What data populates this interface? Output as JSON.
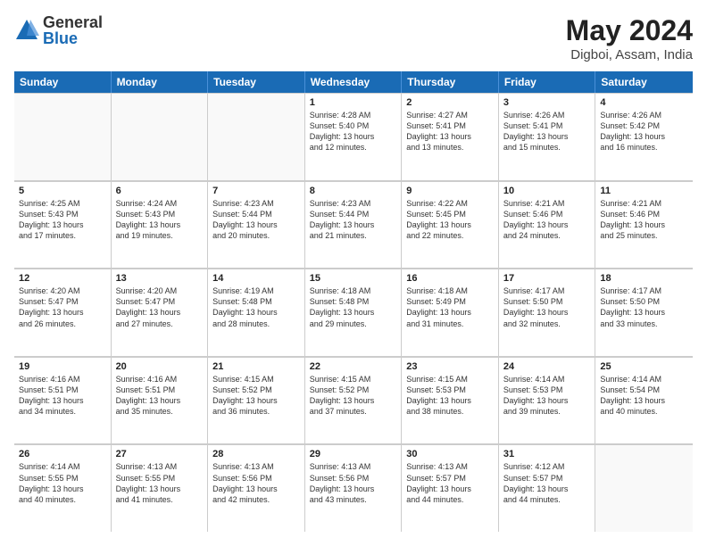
{
  "logo": {
    "general": "General",
    "blue": "Blue"
  },
  "title": "May 2024",
  "subtitle": "Digboi, Assam, India",
  "header_days": [
    "Sunday",
    "Monday",
    "Tuesday",
    "Wednesday",
    "Thursday",
    "Friday",
    "Saturday"
  ],
  "weeks": [
    [
      {
        "day": "",
        "text": ""
      },
      {
        "day": "",
        "text": ""
      },
      {
        "day": "",
        "text": ""
      },
      {
        "day": "1",
        "text": "Sunrise: 4:28 AM\nSunset: 5:40 PM\nDaylight: 13 hours\nand 12 minutes."
      },
      {
        "day": "2",
        "text": "Sunrise: 4:27 AM\nSunset: 5:41 PM\nDaylight: 13 hours\nand 13 minutes."
      },
      {
        "day": "3",
        "text": "Sunrise: 4:26 AM\nSunset: 5:41 PM\nDaylight: 13 hours\nand 15 minutes."
      },
      {
        "day": "4",
        "text": "Sunrise: 4:26 AM\nSunset: 5:42 PM\nDaylight: 13 hours\nand 16 minutes."
      }
    ],
    [
      {
        "day": "5",
        "text": "Sunrise: 4:25 AM\nSunset: 5:43 PM\nDaylight: 13 hours\nand 17 minutes."
      },
      {
        "day": "6",
        "text": "Sunrise: 4:24 AM\nSunset: 5:43 PM\nDaylight: 13 hours\nand 19 minutes."
      },
      {
        "day": "7",
        "text": "Sunrise: 4:23 AM\nSunset: 5:44 PM\nDaylight: 13 hours\nand 20 minutes."
      },
      {
        "day": "8",
        "text": "Sunrise: 4:23 AM\nSunset: 5:44 PM\nDaylight: 13 hours\nand 21 minutes."
      },
      {
        "day": "9",
        "text": "Sunrise: 4:22 AM\nSunset: 5:45 PM\nDaylight: 13 hours\nand 22 minutes."
      },
      {
        "day": "10",
        "text": "Sunrise: 4:21 AM\nSunset: 5:46 PM\nDaylight: 13 hours\nand 24 minutes."
      },
      {
        "day": "11",
        "text": "Sunrise: 4:21 AM\nSunset: 5:46 PM\nDaylight: 13 hours\nand 25 minutes."
      }
    ],
    [
      {
        "day": "12",
        "text": "Sunrise: 4:20 AM\nSunset: 5:47 PM\nDaylight: 13 hours\nand 26 minutes."
      },
      {
        "day": "13",
        "text": "Sunrise: 4:20 AM\nSunset: 5:47 PM\nDaylight: 13 hours\nand 27 minutes."
      },
      {
        "day": "14",
        "text": "Sunrise: 4:19 AM\nSunset: 5:48 PM\nDaylight: 13 hours\nand 28 minutes."
      },
      {
        "day": "15",
        "text": "Sunrise: 4:18 AM\nSunset: 5:48 PM\nDaylight: 13 hours\nand 29 minutes."
      },
      {
        "day": "16",
        "text": "Sunrise: 4:18 AM\nSunset: 5:49 PM\nDaylight: 13 hours\nand 31 minutes."
      },
      {
        "day": "17",
        "text": "Sunrise: 4:17 AM\nSunset: 5:50 PM\nDaylight: 13 hours\nand 32 minutes."
      },
      {
        "day": "18",
        "text": "Sunrise: 4:17 AM\nSunset: 5:50 PM\nDaylight: 13 hours\nand 33 minutes."
      }
    ],
    [
      {
        "day": "19",
        "text": "Sunrise: 4:16 AM\nSunset: 5:51 PM\nDaylight: 13 hours\nand 34 minutes."
      },
      {
        "day": "20",
        "text": "Sunrise: 4:16 AM\nSunset: 5:51 PM\nDaylight: 13 hours\nand 35 minutes."
      },
      {
        "day": "21",
        "text": "Sunrise: 4:15 AM\nSunset: 5:52 PM\nDaylight: 13 hours\nand 36 minutes."
      },
      {
        "day": "22",
        "text": "Sunrise: 4:15 AM\nSunset: 5:52 PM\nDaylight: 13 hours\nand 37 minutes."
      },
      {
        "day": "23",
        "text": "Sunrise: 4:15 AM\nSunset: 5:53 PM\nDaylight: 13 hours\nand 38 minutes."
      },
      {
        "day": "24",
        "text": "Sunrise: 4:14 AM\nSunset: 5:53 PM\nDaylight: 13 hours\nand 39 minutes."
      },
      {
        "day": "25",
        "text": "Sunrise: 4:14 AM\nSunset: 5:54 PM\nDaylight: 13 hours\nand 40 minutes."
      }
    ],
    [
      {
        "day": "26",
        "text": "Sunrise: 4:14 AM\nSunset: 5:55 PM\nDaylight: 13 hours\nand 40 minutes."
      },
      {
        "day": "27",
        "text": "Sunrise: 4:13 AM\nSunset: 5:55 PM\nDaylight: 13 hours\nand 41 minutes."
      },
      {
        "day": "28",
        "text": "Sunrise: 4:13 AM\nSunset: 5:56 PM\nDaylight: 13 hours\nand 42 minutes."
      },
      {
        "day": "29",
        "text": "Sunrise: 4:13 AM\nSunset: 5:56 PM\nDaylight: 13 hours\nand 43 minutes."
      },
      {
        "day": "30",
        "text": "Sunrise: 4:13 AM\nSunset: 5:57 PM\nDaylight: 13 hours\nand 44 minutes."
      },
      {
        "day": "31",
        "text": "Sunrise: 4:12 AM\nSunset: 5:57 PM\nDaylight: 13 hours\nand 44 minutes."
      },
      {
        "day": "",
        "text": ""
      }
    ]
  ]
}
